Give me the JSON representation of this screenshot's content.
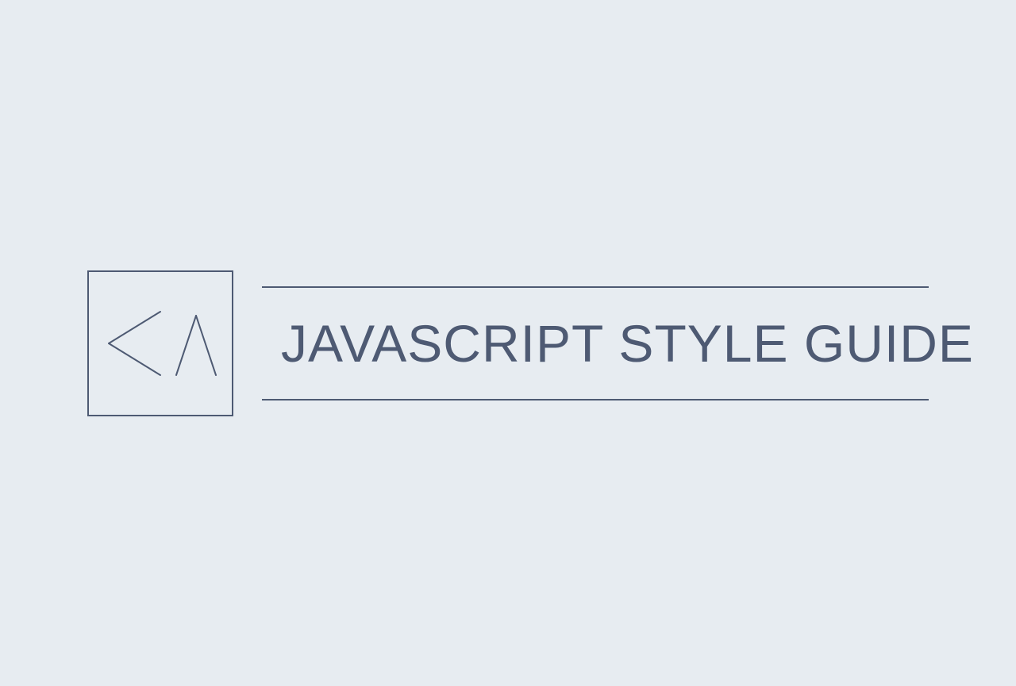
{
  "title": "JAVASCRIPT STYLE GUIDE",
  "colors": {
    "background": "#e7ecf1",
    "foreground": "#4e5a73"
  },
  "logo": {
    "name": "ka-logo"
  }
}
